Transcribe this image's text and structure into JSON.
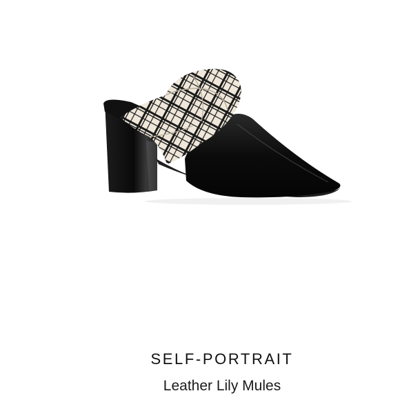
{
  "product": {
    "brand": "SELF-PORTRAIT",
    "name": "Leather Lily Mules",
    "image_icon": "mule-shoe-image"
  },
  "colors": {
    "background": "#ffffff",
    "leather": "#0d0d0d",
    "scarf_base": "#efe7da",
    "scarf_plaid": "#1a1a1a"
  }
}
